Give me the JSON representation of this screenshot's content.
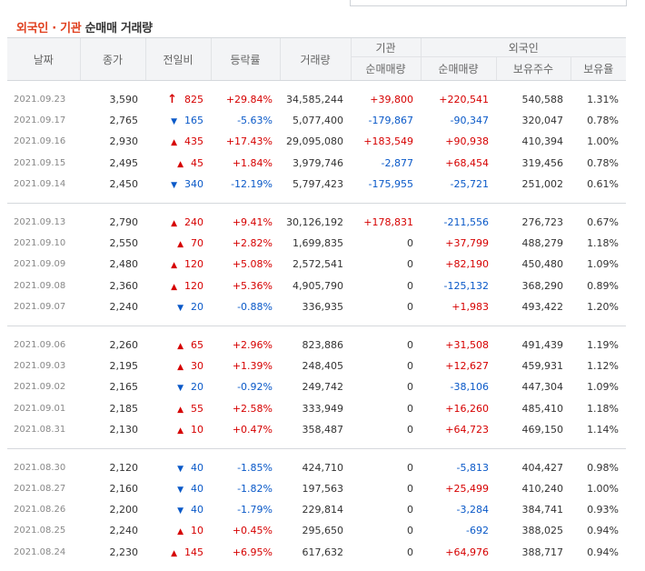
{
  "title": {
    "part1": "외국인 · 기관",
    "part2": "순매매 거래량"
  },
  "columns": {
    "date": "날짜",
    "close": "종가",
    "change": "전일비",
    "rate": "등락률",
    "volume": "거래량",
    "inst_group": "기관",
    "inst_net": "순매매량",
    "foreign_group": "외국인",
    "foreign_net": "순매매량",
    "foreign_hold": "보유주수",
    "foreign_ratio": "보유율"
  },
  "groups": [
    {
      "rows": [
        {
          "date": "2021.09.23",
          "close": "3,590",
          "dir": "up-big",
          "change": "825",
          "rate": "+29.84%",
          "volume": "34,585,244",
          "inst": "+39,800",
          "foreign": "+220,541",
          "hold": "540,588",
          "ratio": "1.31%"
        },
        {
          "date": "2021.09.17",
          "close": "2,765",
          "dir": "down",
          "change": "165",
          "rate": "-5.63%",
          "volume": "5,077,400",
          "inst": "-179,867",
          "foreign": "-90,347",
          "hold": "320,047",
          "ratio": "0.78%"
        },
        {
          "date": "2021.09.16",
          "close": "2,930",
          "dir": "up",
          "change": "435",
          "rate": "+17.43%",
          "volume": "29,095,080",
          "inst": "+183,549",
          "foreign": "+90,938",
          "hold": "410,394",
          "ratio": "1.00%"
        },
        {
          "date": "2021.09.15",
          "close": "2,495",
          "dir": "up",
          "change": "45",
          "rate": "+1.84%",
          "volume": "3,979,746",
          "inst": "-2,877",
          "foreign": "+68,454",
          "hold": "319,456",
          "ratio": "0.78%"
        },
        {
          "date": "2021.09.14",
          "close": "2,450",
          "dir": "down",
          "change": "340",
          "rate": "-12.19%",
          "volume": "5,797,423",
          "inst": "-175,955",
          "foreign": "-25,721",
          "hold": "251,002",
          "ratio": "0.61%"
        }
      ]
    },
    {
      "rows": [
        {
          "date": "2021.09.13",
          "close": "2,790",
          "dir": "up",
          "change": "240",
          "rate": "+9.41%",
          "volume": "30,126,192",
          "inst": "+178,831",
          "foreign": "-211,556",
          "hold": "276,723",
          "ratio": "0.67%"
        },
        {
          "date": "2021.09.10",
          "close": "2,550",
          "dir": "up",
          "change": "70",
          "rate": "+2.82%",
          "volume": "1,699,835",
          "inst": "0",
          "foreign": "+37,799",
          "hold": "488,279",
          "ratio": "1.18%"
        },
        {
          "date": "2021.09.09",
          "close": "2,480",
          "dir": "up",
          "change": "120",
          "rate": "+5.08%",
          "volume": "2,572,541",
          "inst": "0",
          "foreign": "+82,190",
          "hold": "450,480",
          "ratio": "1.09%"
        },
        {
          "date": "2021.09.08",
          "close": "2,360",
          "dir": "up",
          "change": "120",
          "rate": "+5.36%",
          "volume": "4,905,790",
          "inst": "0",
          "foreign": "-125,132",
          "hold": "368,290",
          "ratio": "0.89%"
        },
        {
          "date": "2021.09.07",
          "close": "2,240",
          "dir": "down",
          "change": "20",
          "rate": "-0.88%",
          "volume": "336,935",
          "inst": "0",
          "foreign": "+1,983",
          "hold": "493,422",
          "ratio": "1.20%"
        }
      ]
    },
    {
      "rows": [
        {
          "date": "2021.09.06",
          "close": "2,260",
          "dir": "up",
          "change": "65",
          "rate": "+2.96%",
          "volume": "823,886",
          "inst": "0",
          "foreign": "+31,508",
          "hold": "491,439",
          "ratio": "1.19%"
        },
        {
          "date": "2021.09.03",
          "close": "2,195",
          "dir": "up",
          "change": "30",
          "rate": "+1.39%",
          "volume": "248,405",
          "inst": "0",
          "foreign": "+12,627",
          "hold": "459,931",
          "ratio": "1.12%"
        },
        {
          "date": "2021.09.02",
          "close": "2,165",
          "dir": "down",
          "change": "20",
          "rate": "-0.92%",
          "volume": "249,742",
          "inst": "0",
          "foreign": "-38,106",
          "hold": "447,304",
          "ratio": "1.09%"
        },
        {
          "date": "2021.09.01",
          "close": "2,185",
          "dir": "up",
          "change": "55",
          "rate": "+2.58%",
          "volume": "333,949",
          "inst": "0",
          "foreign": "+16,260",
          "hold": "485,410",
          "ratio": "1.18%"
        },
        {
          "date": "2021.08.31",
          "close": "2,130",
          "dir": "up",
          "change": "10",
          "rate": "+0.47%",
          "volume": "358,487",
          "inst": "0",
          "foreign": "+64,723",
          "hold": "469,150",
          "ratio": "1.14%"
        }
      ]
    },
    {
      "rows": [
        {
          "date": "2021.08.30",
          "close": "2,120",
          "dir": "down",
          "change": "40",
          "rate": "-1.85%",
          "volume": "424,710",
          "inst": "0",
          "foreign": "-5,813",
          "hold": "404,427",
          "ratio": "0.98%"
        },
        {
          "date": "2021.08.27",
          "close": "2,160",
          "dir": "down",
          "change": "40",
          "rate": "-1.82%",
          "volume": "197,563",
          "inst": "0",
          "foreign": "+25,499",
          "hold": "410,240",
          "ratio": "1.00%"
        },
        {
          "date": "2021.08.26",
          "close": "2,200",
          "dir": "down",
          "change": "40",
          "rate": "-1.79%",
          "volume": "229,814",
          "inst": "0",
          "foreign": "-3,284",
          "hold": "384,741",
          "ratio": "0.93%"
        },
        {
          "date": "2021.08.25",
          "close": "2,240",
          "dir": "up",
          "change": "10",
          "rate": "+0.45%",
          "volume": "295,650",
          "inst": "0",
          "foreign": "-692",
          "hold": "388,025",
          "ratio": "0.94%"
        },
        {
          "date": "2021.08.24",
          "close": "2,230",
          "dir": "up",
          "change": "145",
          "rate": "+6.95%",
          "volume": "617,632",
          "inst": "0",
          "foreign": "+64,976",
          "hold": "388,717",
          "ratio": "0.94%"
        }
      ]
    }
  ],
  "icons": {
    "up": "triangle-up-icon",
    "up-big": "arrow-up-icon",
    "down": "triangle-down-icon"
  },
  "colors": {
    "up": "#d60000",
    "down": "#0a59c8",
    "title_accent": "#e0401f"
  }
}
